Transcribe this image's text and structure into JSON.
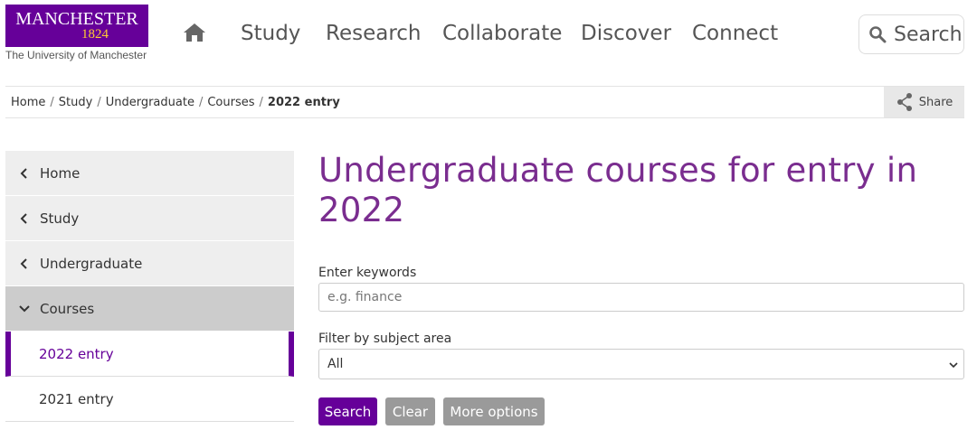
{
  "logo": {
    "name": "MANCHESTER",
    "year": "1824",
    "subtitle": "The University of Manchester"
  },
  "nav": {
    "home_icon": "home-icon",
    "items": [
      "Study",
      "Research",
      "Collaborate",
      "Discover",
      "Connect"
    ],
    "search_label": "Search",
    "search_icon": "search-icon"
  },
  "breadcrumb": {
    "items": [
      "Home",
      "Study",
      "Undergraduate",
      "Courses"
    ],
    "current": "2022 entry",
    "separator": "/"
  },
  "share": {
    "label": "Share",
    "icon": "share-icon"
  },
  "sidebar": {
    "items": [
      {
        "label": "Home",
        "icon": "chevron-left-icon"
      },
      {
        "label": "Study",
        "icon": "chevron-left-icon"
      },
      {
        "label": "Undergraduate",
        "icon": "chevron-left-icon"
      },
      {
        "label": "Courses",
        "icon": "chevron-down-icon"
      },
      {
        "label": "2022 entry"
      },
      {
        "label": "2021 entry"
      }
    ]
  },
  "main": {
    "title": "Undergraduate courses for entry in 2022",
    "keywords_label": "Enter keywords",
    "keywords_placeholder": "e.g. finance",
    "keywords_value": "",
    "filter_label": "Filter by subject area",
    "filter_value": "All",
    "buttons": {
      "search": "Search",
      "clear": "Clear",
      "more": "More options"
    }
  },
  "colors": {
    "brand_purple": "#660099",
    "title_purple": "#7a2d8f",
    "logo_gold": "#ffcc33",
    "button_grey": "#9a9a9a"
  }
}
